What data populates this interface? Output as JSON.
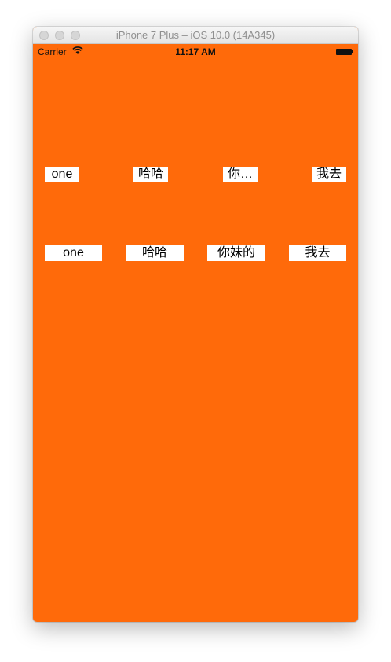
{
  "window": {
    "title": "iPhone 7 Plus – iOS 10.0 (14A345)"
  },
  "status_bar": {
    "carrier": "Carrier",
    "time": "11:17 AM",
    "wifi_icon": "wifi-icon",
    "battery_icon": "battery-icon",
    "battery_level": 1.0
  },
  "colors": {
    "background": "#ff6a0a",
    "button_background": "#ffffff"
  },
  "rows": [
    {
      "buttons": [
        {
          "label": "one"
        },
        {
          "label": "哈哈"
        },
        {
          "label": "你…"
        },
        {
          "label": "我去"
        }
      ]
    },
    {
      "buttons": [
        {
          "label": "one"
        },
        {
          "label": "哈哈"
        },
        {
          "label": "你妹的"
        },
        {
          "label": "我去"
        }
      ]
    }
  ]
}
